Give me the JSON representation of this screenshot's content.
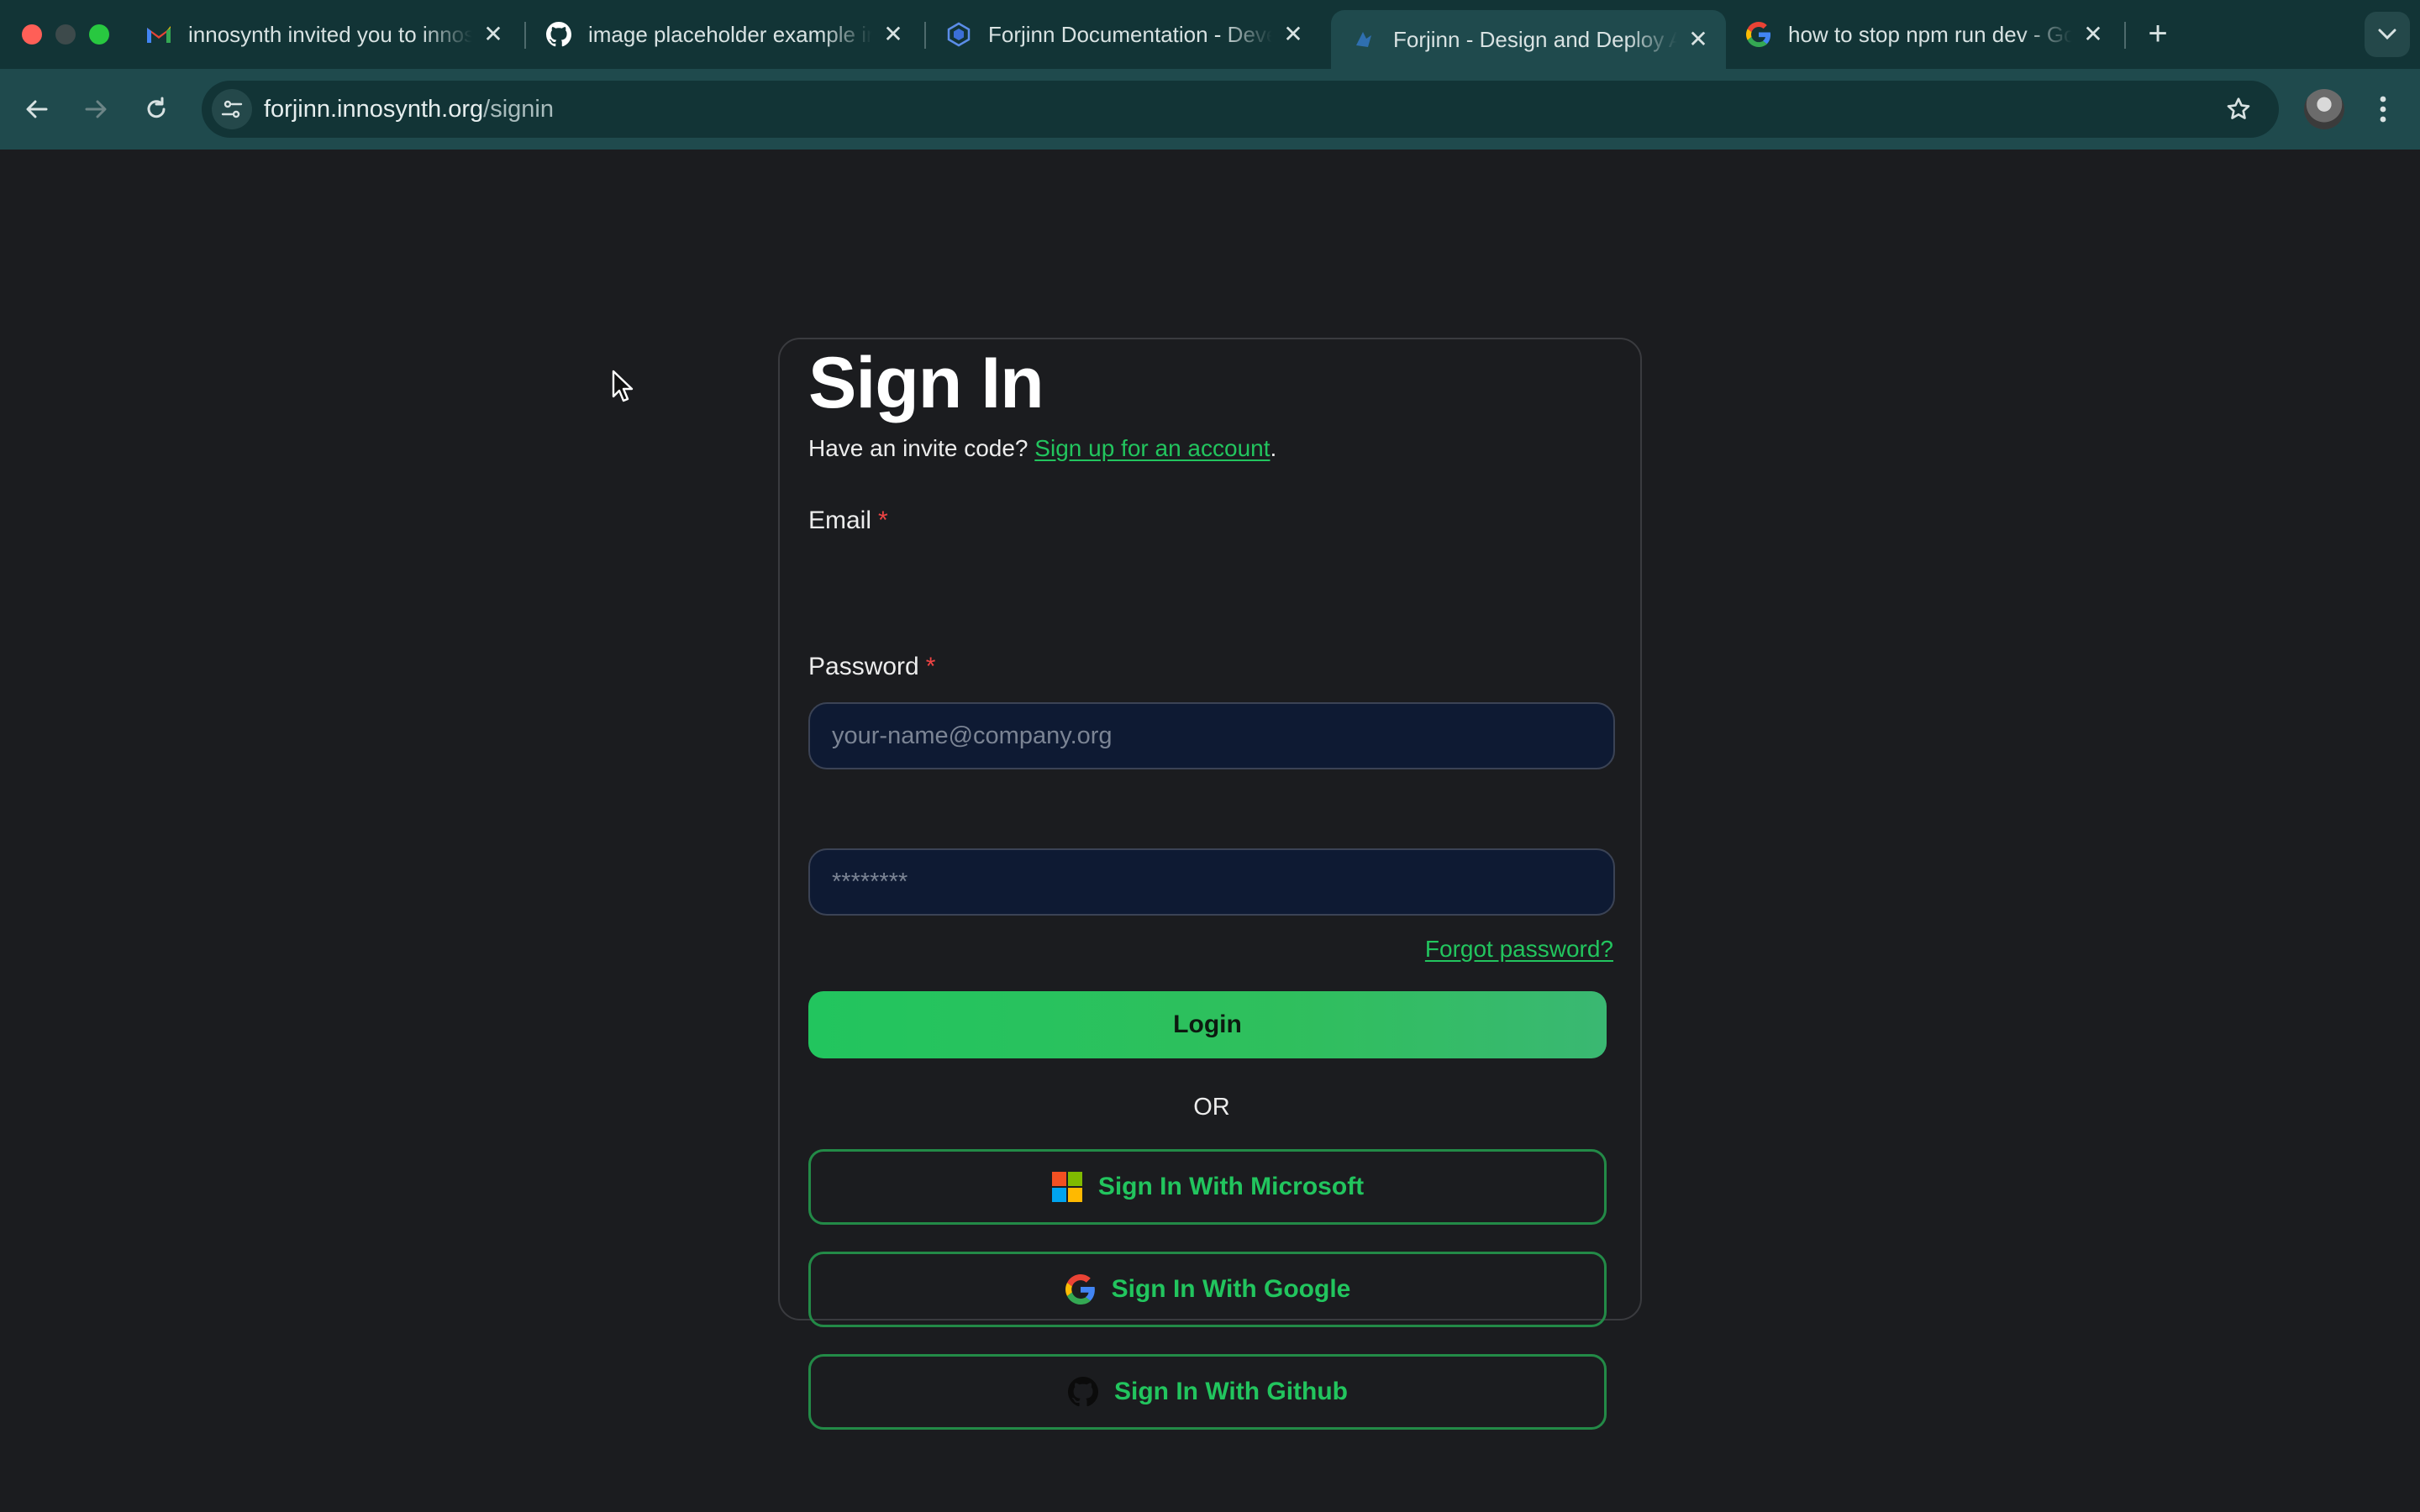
{
  "browser": {
    "tabs": [
      {
        "title": "innosynth invited you to innosynth",
        "icon": "gmail-icon"
      },
      {
        "title": "image placeholder example in markdown",
        "icon": "github-icon"
      },
      {
        "title": "Forjinn Documentation - Developer",
        "icon": "forjinn-docs-icon"
      },
      {
        "title": "Forjinn - Design and Deploy AI",
        "icon": "forjinn-icon",
        "active": true
      },
      {
        "title": "how to stop npm run dev - Google",
        "icon": "google-icon"
      }
    ],
    "url": {
      "host": "forjinn.innosynth.org",
      "path": "/signin"
    }
  },
  "signin": {
    "title": "Sign In",
    "invite_prompt": "Have an invite code?",
    "invite_link": "Sign up for an account",
    "invite_period": ".",
    "email_label": "Email",
    "email_placeholder": "your-name@company.org",
    "password_label": "Password",
    "password_placeholder": "********",
    "required_mark": "*",
    "forgot": "Forgot password?",
    "login": "Login",
    "or": "OR",
    "microsoft": "Sign In With Microsoft",
    "google": "Sign In With Google",
    "github": "Sign In With Github"
  },
  "colors": {
    "accent": "#22c55e",
    "required": "#ef4444",
    "background": "#1b1c1f",
    "input_bg": "#0e1a33"
  }
}
